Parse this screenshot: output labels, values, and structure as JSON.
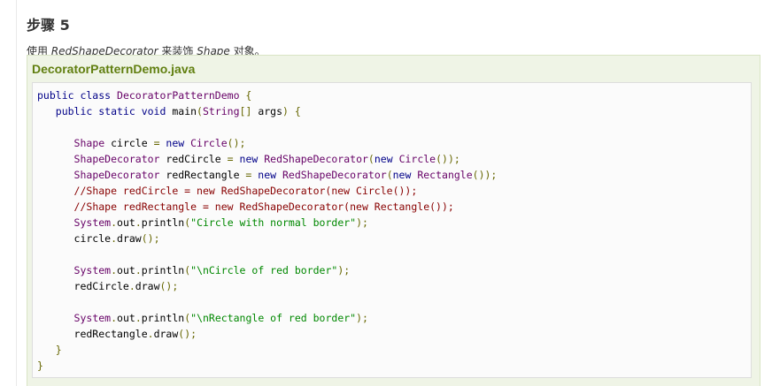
{
  "step": {
    "heading": "步骤 5"
  },
  "intro": {
    "prefix": "使用 ",
    "decorator_class": "RedShapeDecorator",
    "middle": " 来装饰 ",
    "shape_class": "Shape",
    "suffix": " 对象。"
  },
  "example": {
    "file_name": "DecoratorPatternDemo.java",
    "code_lines": [
      [
        {
          "t": "kw",
          "v": "public class "
        },
        {
          "t": "type",
          "v": "DecoratorPatternDemo"
        },
        {
          "t": "pun",
          "v": " {"
        }
      ],
      [
        {
          "t": "pln",
          "v": "   "
        },
        {
          "t": "kw",
          "v": "public static void "
        },
        {
          "t": "pln",
          "v": "main"
        },
        {
          "t": "pun",
          "v": "("
        },
        {
          "t": "type",
          "v": "String"
        },
        {
          "t": "pun",
          "v": "[] "
        },
        {
          "t": "pln",
          "v": "args"
        },
        {
          "t": "pun",
          "v": ") {"
        }
      ],
      [],
      [
        {
          "t": "pln",
          "v": "      "
        },
        {
          "t": "type",
          "v": "Shape"
        },
        {
          "t": "pln",
          "v": " circle "
        },
        {
          "t": "pun",
          "v": "= "
        },
        {
          "t": "kw",
          "v": "new "
        },
        {
          "t": "type",
          "v": "Circle"
        },
        {
          "t": "pun",
          "v": "();"
        }
      ],
      [
        {
          "t": "pln",
          "v": "      "
        },
        {
          "t": "type",
          "v": "ShapeDecorator"
        },
        {
          "t": "pln",
          "v": " redCircle "
        },
        {
          "t": "pun",
          "v": "= "
        },
        {
          "t": "kw",
          "v": "new "
        },
        {
          "t": "type",
          "v": "RedShapeDecorator"
        },
        {
          "t": "pun",
          "v": "("
        },
        {
          "t": "kw",
          "v": "new "
        },
        {
          "t": "type",
          "v": "Circle"
        },
        {
          "t": "pun",
          "v": "());"
        }
      ],
      [
        {
          "t": "pln",
          "v": "      "
        },
        {
          "t": "type",
          "v": "ShapeDecorator"
        },
        {
          "t": "pln",
          "v": " redRectangle "
        },
        {
          "t": "pun",
          "v": "= "
        },
        {
          "t": "kw",
          "v": "new "
        },
        {
          "t": "type",
          "v": "RedShapeDecorator"
        },
        {
          "t": "pun",
          "v": "("
        },
        {
          "t": "kw",
          "v": "new "
        },
        {
          "t": "type",
          "v": "Rectangle"
        },
        {
          "t": "pun",
          "v": "());"
        }
      ],
      [
        {
          "t": "pln",
          "v": "      "
        },
        {
          "t": "com",
          "v": "//Shape redCircle = new RedShapeDecorator(new Circle());"
        }
      ],
      [
        {
          "t": "pln",
          "v": "      "
        },
        {
          "t": "com",
          "v": "//Shape redRectangle = new RedShapeDecorator(new Rectangle());"
        }
      ],
      [
        {
          "t": "pln",
          "v": "      "
        },
        {
          "t": "type",
          "v": "System"
        },
        {
          "t": "pun",
          "v": "."
        },
        {
          "t": "pln",
          "v": "out"
        },
        {
          "t": "pun",
          "v": "."
        },
        {
          "t": "pln",
          "v": "println"
        },
        {
          "t": "pun",
          "v": "("
        },
        {
          "t": "str",
          "v": "\"Circle with normal border\""
        },
        {
          "t": "pun",
          "v": ");"
        }
      ],
      [
        {
          "t": "pln",
          "v": "      circle"
        },
        {
          "t": "pun",
          "v": "."
        },
        {
          "t": "pln",
          "v": "draw"
        },
        {
          "t": "pun",
          "v": "();"
        }
      ],
      [],
      [
        {
          "t": "pln",
          "v": "      "
        },
        {
          "t": "type",
          "v": "System"
        },
        {
          "t": "pun",
          "v": "."
        },
        {
          "t": "pln",
          "v": "out"
        },
        {
          "t": "pun",
          "v": "."
        },
        {
          "t": "pln",
          "v": "println"
        },
        {
          "t": "pun",
          "v": "("
        },
        {
          "t": "str",
          "v": "\"\\nCircle of red border\""
        },
        {
          "t": "pun",
          "v": ");"
        }
      ],
      [
        {
          "t": "pln",
          "v": "      redCircle"
        },
        {
          "t": "pun",
          "v": "."
        },
        {
          "t": "pln",
          "v": "draw"
        },
        {
          "t": "pun",
          "v": "();"
        }
      ],
      [],
      [
        {
          "t": "pln",
          "v": "      "
        },
        {
          "t": "type",
          "v": "System"
        },
        {
          "t": "pun",
          "v": "."
        },
        {
          "t": "pln",
          "v": "out"
        },
        {
          "t": "pun",
          "v": "."
        },
        {
          "t": "pln",
          "v": "println"
        },
        {
          "t": "pun",
          "v": "("
        },
        {
          "t": "str",
          "v": "\"\\nRectangle of red border\""
        },
        {
          "t": "pun",
          "v": ");"
        }
      ],
      [
        {
          "t": "pln",
          "v": "      redRectangle"
        },
        {
          "t": "pun",
          "v": "."
        },
        {
          "t": "pln",
          "v": "draw"
        },
        {
          "t": "pun",
          "v": "();"
        }
      ],
      [
        {
          "t": "pln",
          "v": "   "
        },
        {
          "t": "pun",
          "v": "}"
        }
      ],
      [
        {
          "t": "pun",
          "v": "}"
        }
      ]
    ]
  },
  "colors": {
    "file_title": "#617f10",
    "box_background": "#eff4e6",
    "code_background": "#fbfbfb",
    "keyword": "#000088",
    "type": "#660066",
    "string": "#008800",
    "comment": "#880000"
  }
}
